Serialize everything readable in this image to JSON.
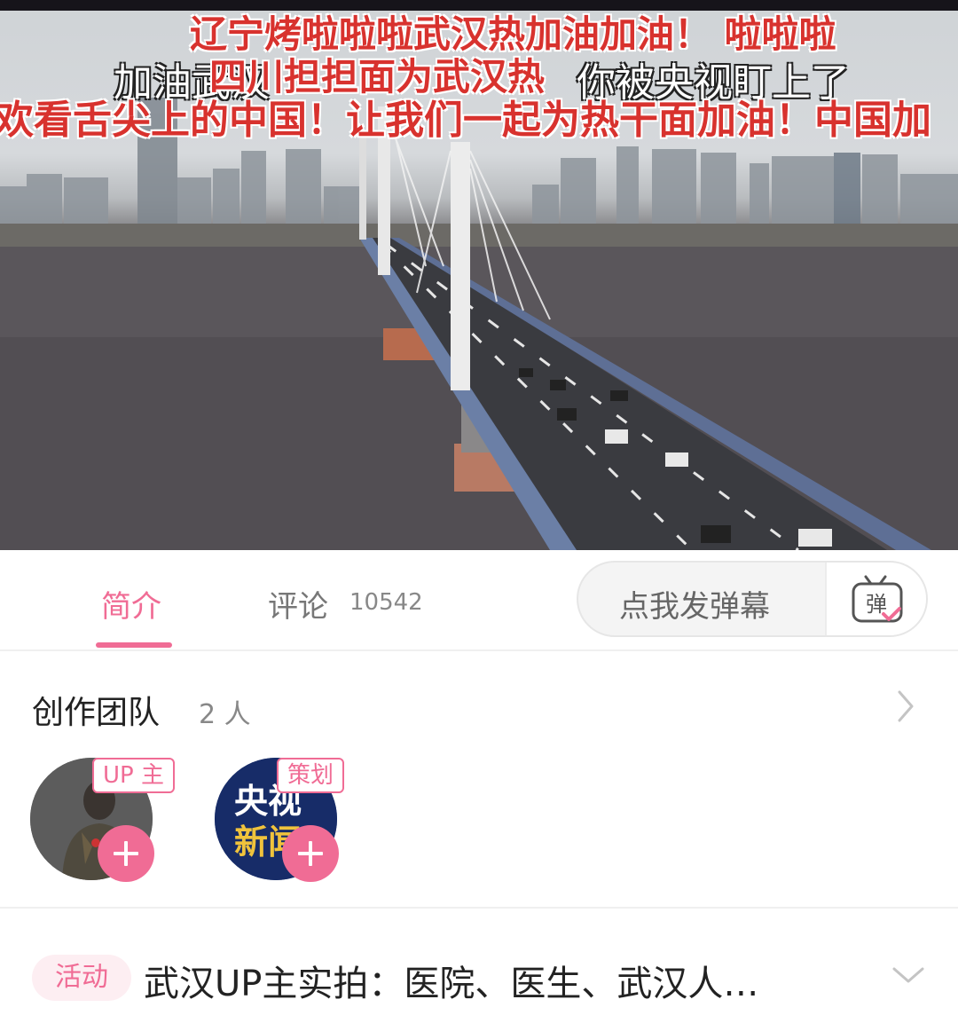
{
  "video": {
    "danmaku": [
      "辽宁烤啦啦啦武汉热加油加油！ 啦啦啦",
      "加油武汉",
      "四川担担面为武汉热",
      "你被央视盯上了",
      "欢看舌尖上的中国！让我们一起为热干面加油！中国加"
    ]
  },
  "tabs": {
    "intro_label": "简介",
    "comments_label": "评论",
    "comments_count": "10542",
    "danmaku_placeholder": "点我发弹幕",
    "danmaku_icon_char": "弹"
  },
  "team": {
    "title": "创作团队",
    "count": "2 人",
    "members": [
      {
        "role": "UP 主"
      },
      {
        "role": "策划",
        "avatar_text_top": "央视",
        "avatar_text_bottom": "新闻"
      }
    ]
  },
  "activity": {
    "badge": "活动",
    "text": "武汉UP主实拍：医院、医生、武汉人…"
  },
  "colors": {
    "accent": "#f06c95",
    "danmaku_red": "#d8322e"
  }
}
